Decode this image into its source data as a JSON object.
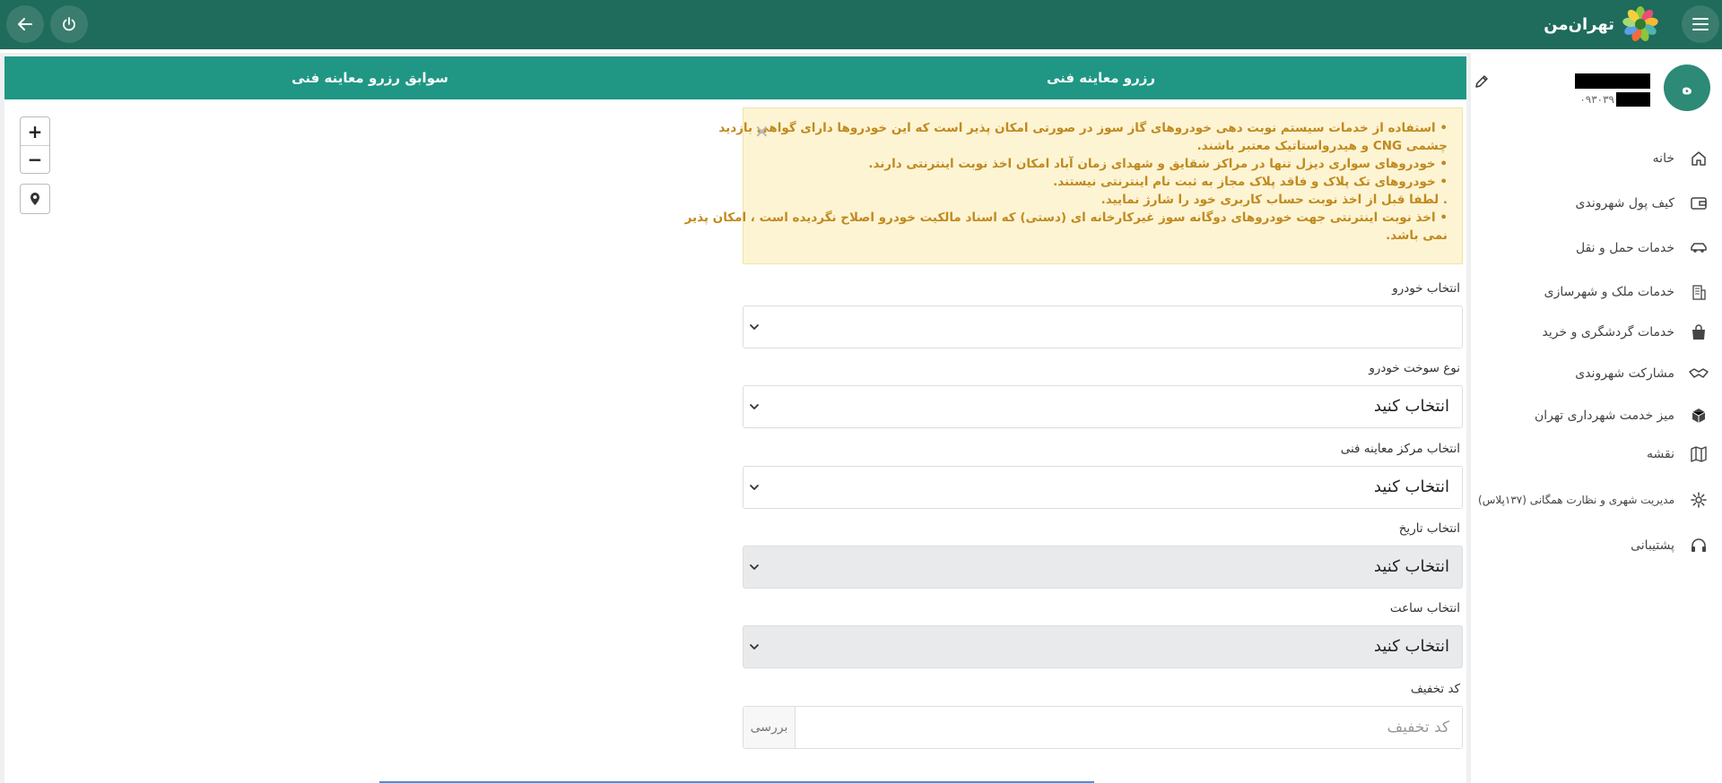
{
  "header": {
    "logo_text": "تهران‌من",
    "menu_icon": "hamburger-icon",
    "back_icon": "arrow-left-icon",
    "power_icon": "power-icon"
  },
  "profile": {
    "avatar_letter": "ه",
    "phone_visible": "۰۹۳۰۳۹"
  },
  "sidebar": {
    "items": [
      {
        "label": "خانه",
        "icon": "home-icon"
      },
      {
        "label": "کیف پول شهروندی",
        "icon": "wallet-icon"
      },
      {
        "label": "خدمات حمل و نقل",
        "icon": "car-icon"
      },
      {
        "label": "خدمات ملک و شهرسازی",
        "icon": "building-icon"
      },
      {
        "label": "خدمات گردشگری و خرید",
        "icon": "shopping-bag-icon"
      },
      {
        "label": "مشارکت شهروندی",
        "icon": "handshake-icon"
      },
      {
        "label": "میز خدمت شهرداری تهران",
        "icon": "cube-icon"
      },
      {
        "label": "نقشه",
        "icon": "map-icon"
      },
      {
        "label": "مدیریت شهری و نظارت همگانی (۱۳۷پلاس)",
        "icon": "gear-icon"
      },
      {
        "label": "پشتیبانی",
        "icon": "headset-icon"
      }
    ]
  },
  "tabs": [
    {
      "label": "سوابق رزرو معاینه فنی"
    },
    {
      "label": "رزرو معاینه فنی"
    }
  ],
  "map": {
    "zoom_in": "+",
    "zoom_out": "−"
  },
  "notice": {
    "lines": [
      "• استفاده از خدمات سیستم نوبت دهی خودروهای گاز سوز در صورتی امکان پذیر است که این خودروها دارای گواهی بازدید",
      "چشمی CNG و هیدرواستاتیک معتبر باشند.",
      "• خودروهای سواری دیزل تنها در مراکز شقایق و شهدای زمان آباد امکان اخذ نوبت اینترنتی دارند.",
      "• خودروهای تک پلاک و فاقد پلاک مجاز به ثبت نام اینترنتی نیستند.",
      ". لطفا قبل از اخذ نوبت حساب کاربری خود را شارژ نمایید.",
      "• اخذ نوبت اینترنتی جهت خودروهای دوگانه سوز غیرکارخانه ای (دستی) که اسناد مالکیت خودرو اصلاح نگردیده است ، امکان پذیر",
      "نمی باشد."
    ],
    "close": "✕"
  },
  "form": {
    "vehicle": {
      "label": "انتخاب خودرو",
      "value": ""
    },
    "fuel": {
      "label": "نوع سوخت خودرو",
      "value": "انتخاب کنید"
    },
    "center": {
      "label": "انتخاب مرکز معاینه فنی",
      "value": "انتخاب کنید"
    },
    "date": {
      "label": "انتخاب تاریخ",
      "value": "انتخاب کنید"
    },
    "time": {
      "label": "انتخاب ساعت",
      "value": "انتخاب کنید"
    },
    "discount": {
      "label": "کد تخفیف",
      "placeholder": "کد تخفیف",
      "button": "بررسی"
    }
  },
  "colors": {
    "header": "#1f6b5c",
    "tabs": "#1f9784",
    "notice_bg": "#fdf4d4",
    "notice_text": "#c08a1f"
  }
}
